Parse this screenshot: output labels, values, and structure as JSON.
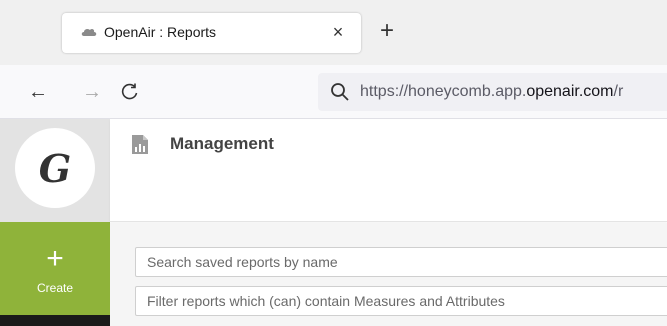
{
  "browser": {
    "tab": {
      "title": "OpenAir : Reports",
      "close_glyph": "×",
      "favicon": "cloud-icon"
    },
    "new_tab_glyph": "+",
    "nav": {
      "back_glyph": "←",
      "forward_glyph": "→",
      "reload_glyph": "C"
    },
    "url": {
      "prefix": "https://honeycomb.app.",
      "domain": "openair.com",
      "suffix": "/r"
    }
  },
  "sidebar": {
    "logo_letter": "G",
    "create_label": "Create",
    "create_glyph": "+"
  },
  "main": {
    "title": "Management",
    "title_icon": "report-chart-icon",
    "search": {
      "placeholder": "Search saved reports by name"
    },
    "filter": {
      "placeholder": "Filter reports which (can) contain Measures and Attributes"
    }
  },
  "colors": {
    "accent_green": "#8fb33a",
    "sidebar_gray": "#e3e3e3"
  }
}
